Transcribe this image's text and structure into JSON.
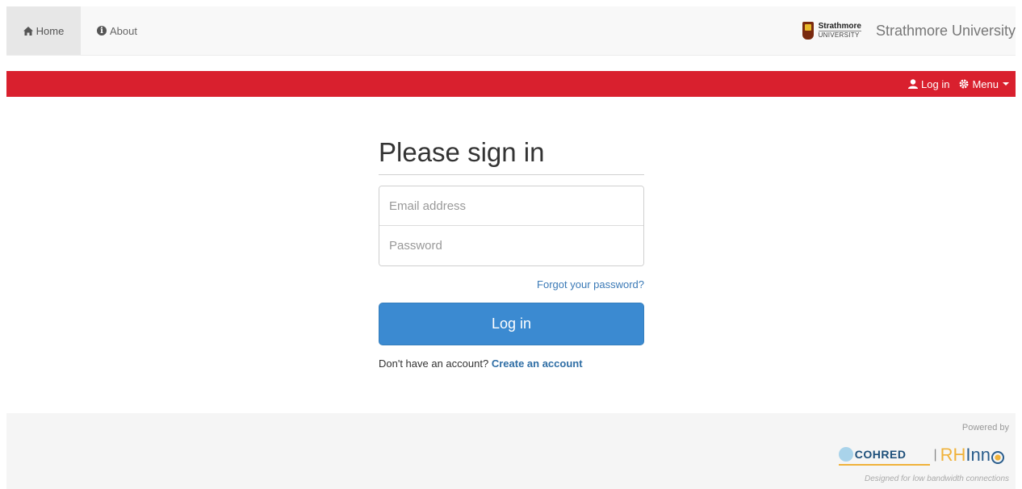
{
  "nav": {
    "home_label": "Home",
    "about_label": "About",
    "logo_line1": "Strathmore",
    "logo_line2": "UNIVERSITY",
    "brand_name": "Strathmore University"
  },
  "redbar": {
    "login_label": "Log in",
    "menu_label": "Menu"
  },
  "signin": {
    "title": "Please sign in",
    "email_placeholder": "Email address",
    "password_placeholder": "Password",
    "forgot_label": "Forgot your password?",
    "login_button": "Log in",
    "no_account_text": "Don't have an account?",
    "create_account_label": "Create an account"
  },
  "footer": {
    "powered_by": "Powered by",
    "partner1": "COHRED",
    "partner2_rh": "RH",
    "partner2_inno": "Inn",
    "tagline": "Designed for low bandwidth connections"
  },
  "colors": {
    "accent_red": "#d9202e",
    "button_blue": "#3b8ad1",
    "link_blue": "#3a79b6"
  }
}
